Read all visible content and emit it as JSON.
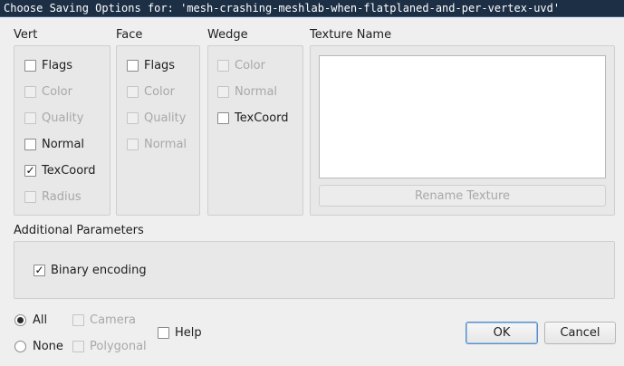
{
  "window": {
    "title": "Choose Saving Options for: 'mesh-crashing-meshlab-when-flatplaned-and-per-vertex-uvd'"
  },
  "vert": {
    "title": "Vert",
    "items": [
      {
        "label": "Flags",
        "checked": false,
        "enabled": true
      },
      {
        "label": "Color",
        "checked": false,
        "enabled": false
      },
      {
        "label": "Quality",
        "checked": false,
        "enabled": false
      },
      {
        "label": "Normal",
        "checked": false,
        "enabled": true
      },
      {
        "label": "TexCoord",
        "checked": true,
        "enabled": true
      },
      {
        "label": "Radius",
        "checked": false,
        "enabled": false
      }
    ]
  },
  "face": {
    "title": "Face",
    "items": [
      {
        "label": "Flags",
        "checked": false,
        "enabled": true
      },
      {
        "label": "Color",
        "checked": false,
        "enabled": false
      },
      {
        "label": "Quality",
        "checked": false,
        "enabled": false
      },
      {
        "label": "Normal",
        "checked": false,
        "enabled": false
      }
    ]
  },
  "wedge": {
    "title": "Wedge",
    "items": [
      {
        "label": "Color",
        "checked": false,
        "enabled": false
      },
      {
        "label": "Normal",
        "checked": false,
        "enabled": false
      },
      {
        "label": "TexCoord",
        "checked": false,
        "enabled": true
      }
    ]
  },
  "texture": {
    "title": "Texture Name",
    "rename_label": "Rename Texture"
  },
  "additional": {
    "title": "Additional Parameters",
    "binary_label": "Binary encoding",
    "binary_checked": true
  },
  "bottom": {
    "all_label": "All",
    "none_label": "None",
    "camera_label": "Camera",
    "polygonal_label": "Polygonal",
    "help_label": "Help",
    "ok_label": "OK",
    "cancel_label": "Cancel"
  },
  "check_glyph": "✓"
}
